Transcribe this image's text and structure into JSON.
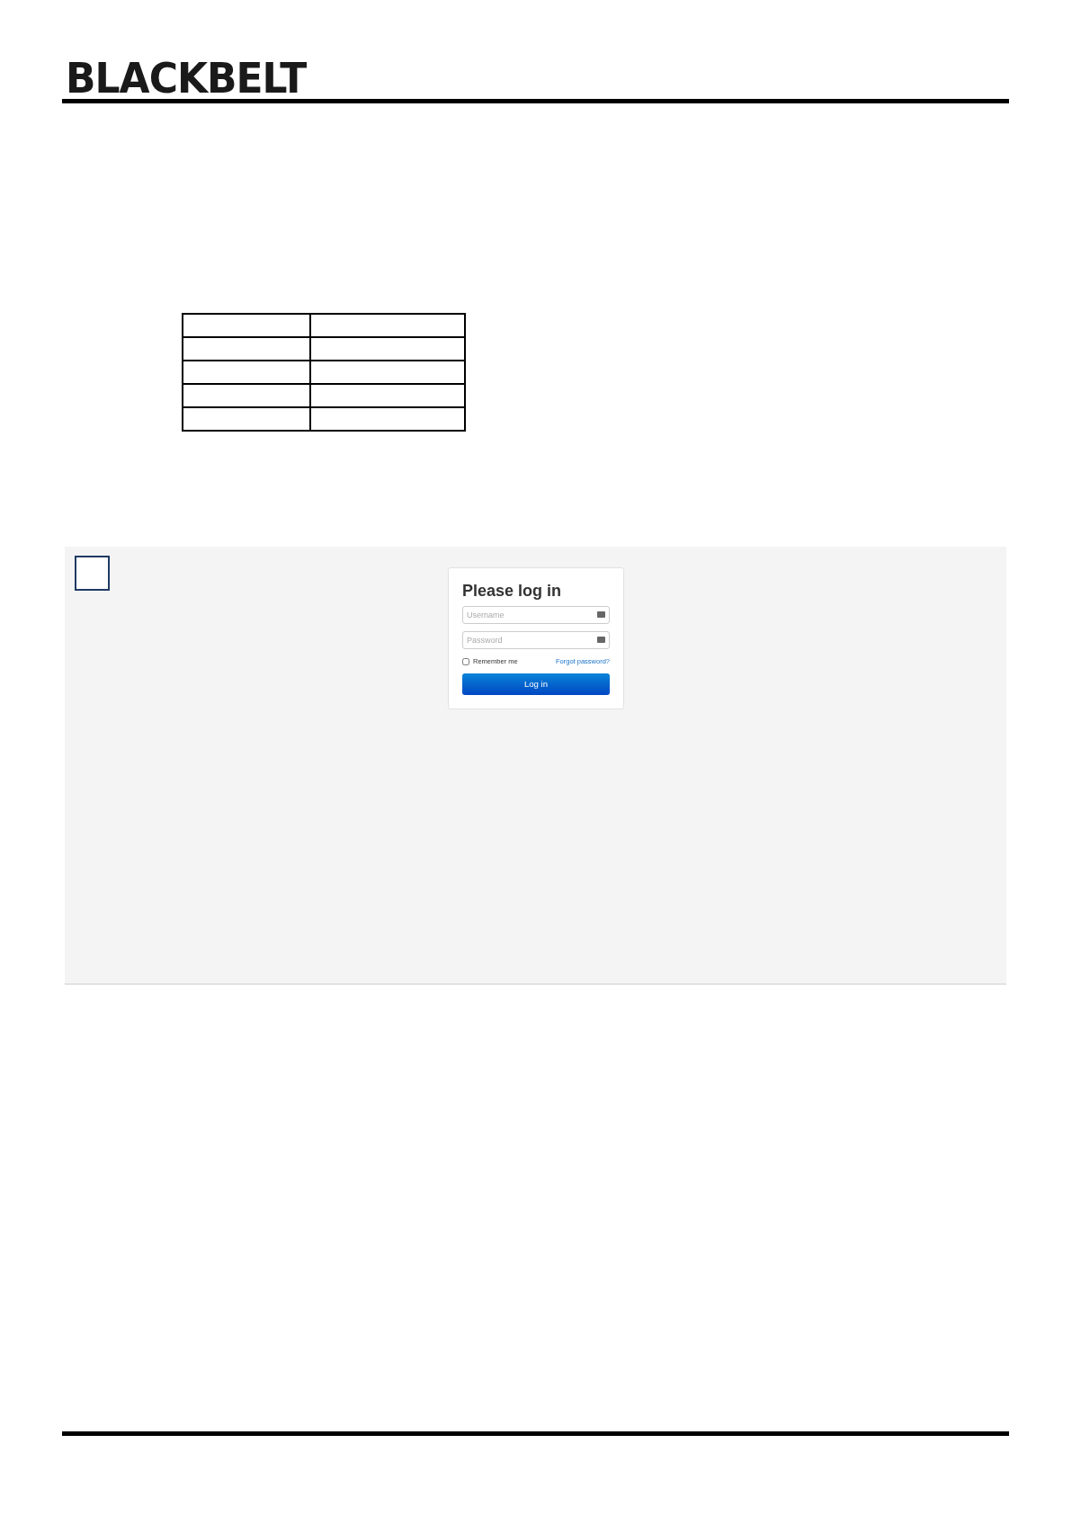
{
  "header": {
    "logo": "BLACKBELT"
  },
  "screenshot": {
    "login": {
      "title": "Please log in",
      "username": {
        "placeholder": "Username"
      },
      "password": {
        "placeholder": "Password"
      },
      "remember": {
        "label": "Remember me",
        "checked": false
      },
      "forgot_link": "Forgot password?",
      "button": "Log in"
    }
  }
}
